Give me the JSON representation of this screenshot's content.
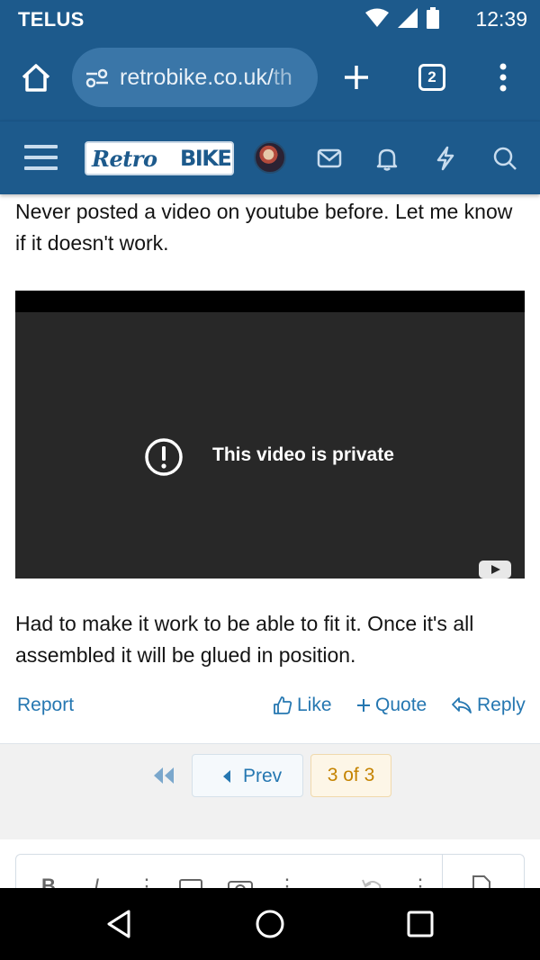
{
  "status_bar": {
    "carrier": "TELUS",
    "time": "12:39",
    "icons": [
      "wifi-icon",
      "cell-signal-icon",
      "battery-icon"
    ]
  },
  "browser": {
    "url_main": "retrobike.co.uk/",
    "url_faded": "th",
    "tab_count": "2",
    "icons": [
      "home-icon",
      "site-settings-icon",
      "new-tab-plus-icon",
      "more-vert-icon"
    ]
  },
  "site_header": {
    "logo_part1": "Retro",
    "logo_part2": "BIKE",
    "icons": [
      "menu-hamburger-icon",
      "avatar",
      "mail-icon",
      "bell-icon",
      "lightning-icon",
      "search-icon"
    ]
  },
  "post": {
    "text_top": "Never posted a video on youtube before. Let me know if it doesn't work.",
    "video_message": "This video is private",
    "text_bottom": "Had to make it work to be able to fit it. Once it's all assembled it will be glued in position."
  },
  "actions": {
    "report": "Report",
    "like": "Like",
    "quote": "Quote",
    "reply": "Reply"
  },
  "pagination": {
    "prev": "Prev",
    "page_indicator": "3 of 3"
  },
  "editor": {
    "tools": [
      "B",
      "I",
      "⋮",
      "image",
      "camera",
      "⋮",
      "undo",
      "⋮",
      "paste"
    ]
  },
  "colors": {
    "brand": "#1d5a8c",
    "link": "#2577b1",
    "page_highlight": "#c58300"
  }
}
